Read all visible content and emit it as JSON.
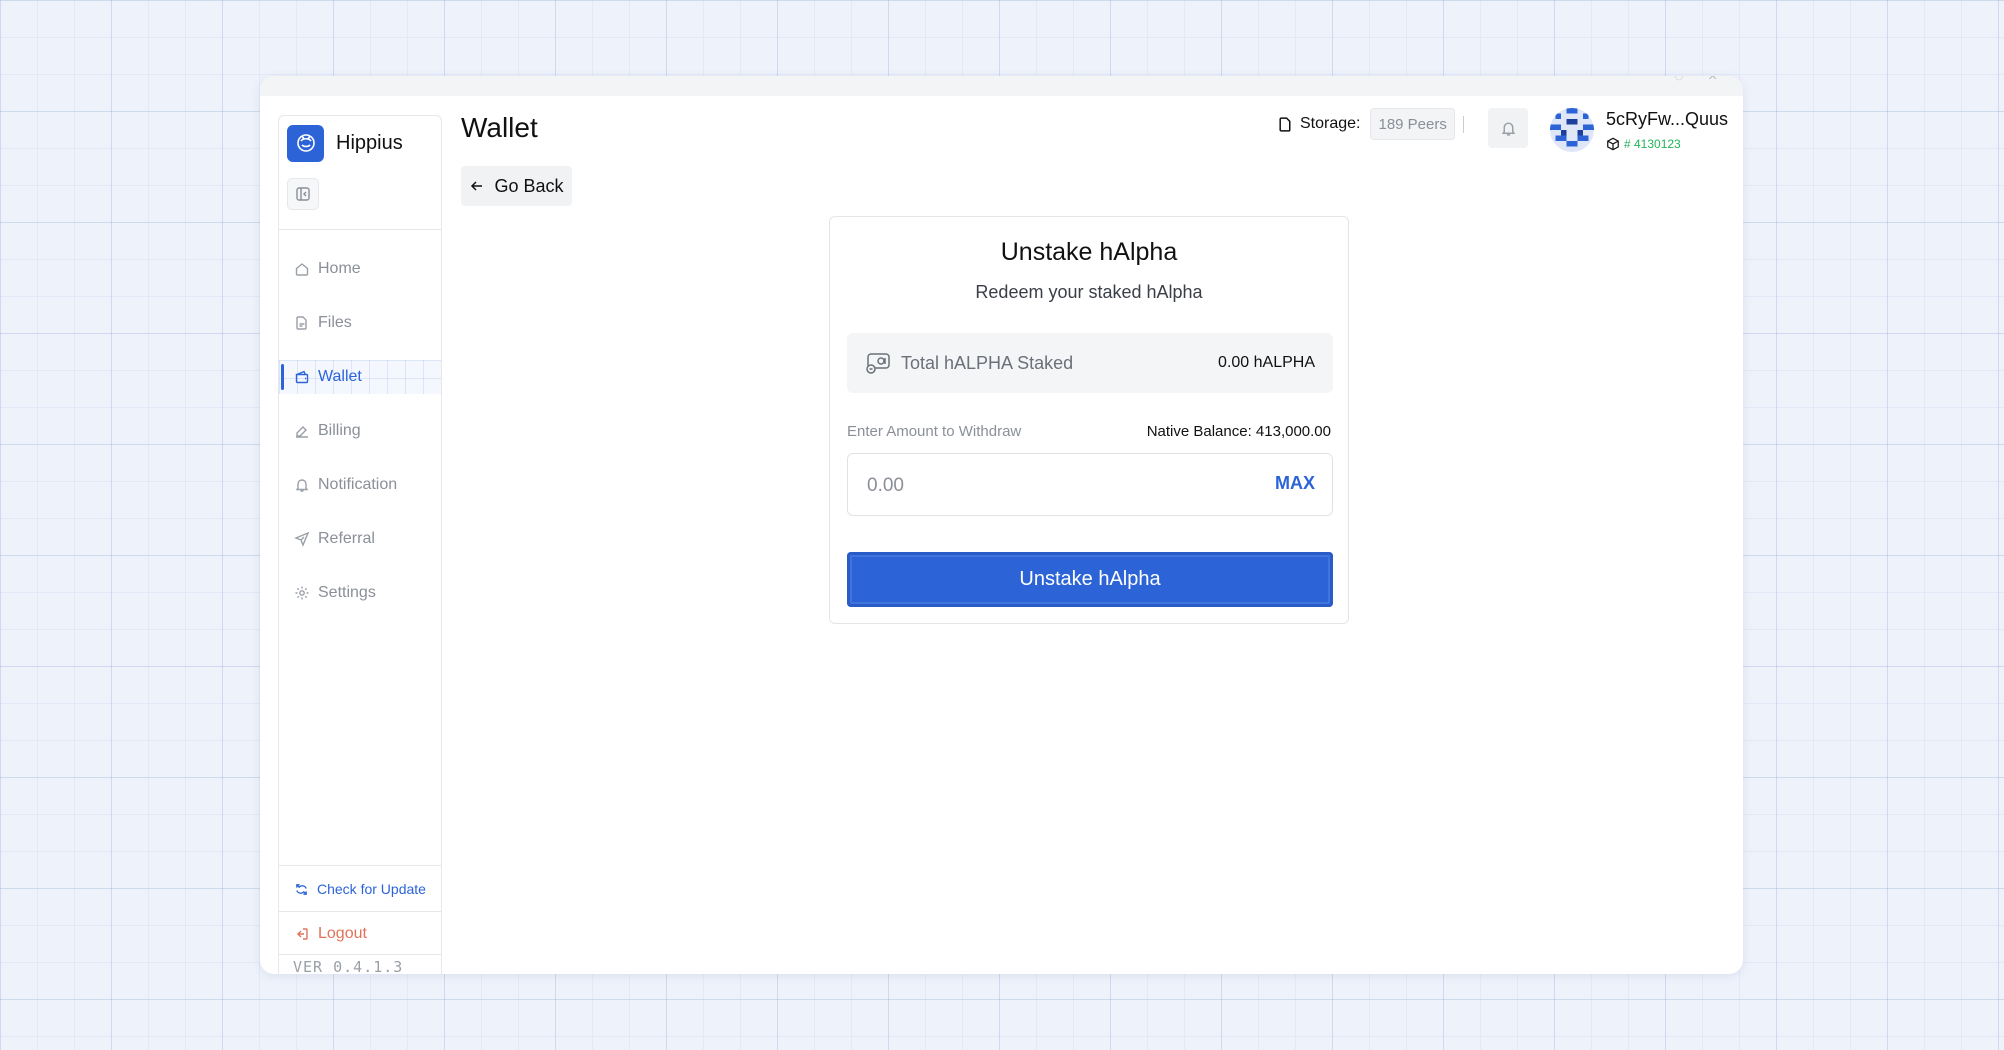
{
  "app": {
    "name": "Hippius",
    "version": "VER 0.4.1.3"
  },
  "sidebar": {
    "items": [
      {
        "label": "Home",
        "icon": "home-icon",
        "active": false
      },
      {
        "label": "Files",
        "icon": "file-icon",
        "active": false
      },
      {
        "label": "Wallet",
        "icon": "wallet-icon",
        "active": true
      },
      {
        "label": "Billing",
        "icon": "billing-icon",
        "active": false
      },
      {
        "label": "Notification",
        "icon": "bell-icon",
        "active": false
      },
      {
        "label": "Referral",
        "icon": "send-icon",
        "active": false
      },
      {
        "label": "Settings",
        "icon": "gear-icon",
        "active": false
      }
    ],
    "check_update": "Check for Update",
    "logout": "Logout"
  },
  "header": {
    "title": "Wallet",
    "storage_label": "Storage:",
    "peers": "189 Peers",
    "username": "5cRyFw...Quus",
    "block": "# 4130123"
  },
  "go_back": "Go Back",
  "card": {
    "title": "Unstake hAlpha",
    "subtitle": "Redeem your staked hAlpha",
    "staked_label": "Total hALPHA Staked",
    "staked_value": "0.00 hALPHA",
    "amount_label": "Enter Amount to Withdraw",
    "native_balance": "Native Balance: 413,000.00",
    "amount_placeholder": "0.00",
    "max_label": "MAX",
    "submit_label": "Unstake hAlpha"
  },
  "colors": {
    "accent": "#2c64d8",
    "success": "#22b55a",
    "logout": "#e2725b"
  }
}
